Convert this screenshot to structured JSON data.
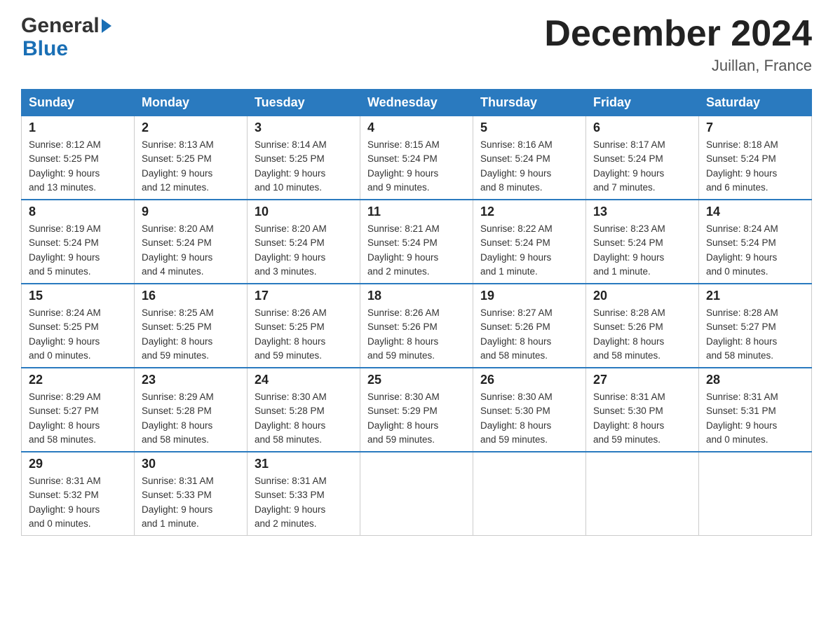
{
  "header": {
    "title": "December 2024",
    "location": "Juillan, France"
  },
  "logo": {
    "line1": "General",
    "line2": "Blue"
  },
  "weekdays": [
    "Sunday",
    "Monday",
    "Tuesday",
    "Wednesday",
    "Thursday",
    "Friday",
    "Saturday"
  ],
  "weeks": [
    [
      {
        "day": "1",
        "sunrise": "Sunrise: 8:12 AM",
        "sunset": "Sunset: 5:25 PM",
        "daylight": "Daylight: 9 hours",
        "minutes": "and 13 minutes."
      },
      {
        "day": "2",
        "sunrise": "Sunrise: 8:13 AM",
        "sunset": "Sunset: 5:25 PM",
        "daylight": "Daylight: 9 hours",
        "minutes": "and 12 minutes."
      },
      {
        "day": "3",
        "sunrise": "Sunrise: 8:14 AM",
        "sunset": "Sunset: 5:25 PM",
        "daylight": "Daylight: 9 hours",
        "minutes": "and 10 minutes."
      },
      {
        "day": "4",
        "sunrise": "Sunrise: 8:15 AM",
        "sunset": "Sunset: 5:24 PM",
        "daylight": "Daylight: 9 hours",
        "minutes": "and 9 minutes."
      },
      {
        "day": "5",
        "sunrise": "Sunrise: 8:16 AM",
        "sunset": "Sunset: 5:24 PM",
        "daylight": "Daylight: 9 hours",
        "minutes": "and 8 minutes."
      },
      {
        "day": "6",
        "sunrise": "Sunrise: 8:17 AM",
        "sunset": "Sunset: 5:24 PM",
        "daylight": "Daylight: 9 hours",
        "minutes": "and 7 minutes."
      },
      {
        "day": "7",
        "sunrise": "Sunrise: 8:18 AM",
        "sunset": "Sunset: 5:24 PM",
        "daylight": "Daylight: 9 hours",
        "minutes": "and 6 minutes."
      }
    ],
    [
      {
        "day": "8",
        "sunrise": "Sunrise: 8:19 AM",
        "sunset": "Sunset: 5:24 PM",
        "daylight": "Daylight: 9 hours",
        "minutes": "and 5 minutes."
      },
      {
        "day": "9",
        "sunrise": "Sunrise: 8:20 AM",
        "sunset": "Sunset: 5:24 PM",
        "daylight": "Daylight: 9 hours",
        "minutes": "and 4 minutes."
      },
      {
        "day": "10",
        "sunrise": "Sunrise: 8:20 AM",
        "sunset": "Sunset: 5:24 PM",
        "daylight": "Daylight: 9 hours",
        "minutes": "and 3 minutes."
      },
      {
        "day": "11",
        "sunrise": "Sunrise: 8:21 AM",
        "sunset": "Sunset: 5:24 PM",
        "daylight": "Daylight: 9 hours",
        "minutes": "and 2 minutes."
      },
      {
        "day": "12",
        "sunrise": "Sunrise: 8:22 AM",
        "sunset": "Sunset: 5:24 PM",
        "daylight": "Daylight: 9 hours",
        "minutes": "and 1 minute."
      },
      {
        "day": "13",
        "sunrise": "Sunrise: 8:23 AM",
        "sunset": "Sunset: 5:24 PM",
        "daylight": "Daylight: 9 hours",
        "minutes": "and 1 minute."
      },
      {
        "day": "14",
        "sunrise": "Sunrise: 8:24 AM",
        "sunset": "Sunset: 5:24 PM",
        "daylight": "Daylight: 9 hours",
        "minutes": "and 0 minutes."
      }
    ],
    [
      {
        "day": "15",
        "sunrise": "Sunrise: 8:24 AM",
        "sunset": "Sunset: 5:25 PM",
        "daylight": "Daylight: 9 hours",
        "minutes": "and 0 minutes."
      },
      {
        "day": "16",
        "sunrise": "Sunrise: 8:25 AM",
        "sunset": "Sunset: 5:25 PM",
        "daylight": "Daylight: 8 hours",
        "minutes": "and 59 minutes."
      },
      {
        "day": "17",
        "sunrise": "Sunrise: 8:26 AM",
        "sunset": "Sunset: 5:25 PM",
        "daylight": "Daylight: 8 hours",
        "minutes": "and 59 minutes."
      },
      {
        "day": "18",
        "sunrise": "Sunrise: 8:26 AM",
        "sunset": "Sunset: 5:26 PM",
        "daylight": "Daylight: 8 hours",
        "minutes": "and 59 minutes."
      },
      {
        "day": "19",
        "sunrise": "Sunrise: 8:27 AM",
        "sunset": "Sunset: 5:26 PM",
        "daylight": "Daylight: 8 hours",
        "minutes": "and 58 minutes."
      },
      {
        "day": "20",
        "sunrise": "Sunrise: 8:28 AM",
        "sunset": "Sunset: 5:26 PM",
        "daylight": "Daylight: 8 hours",
        "minutes": "and 58 minutes."
      },
      {
        "day": "21",
        "sunrise": "Sunrise: 8:28 AM",
        "sunset": "Sunset: 5:27 PM",
        "daylight": "Daylight: 8 hours",
        "minutes": "and 58 minutes."
      }
    ],
    [
      {
        "day": "22",
        "sunrise": "Sunrise: 8:29 AM",
        "sunset": "Sunset: 5:27 PM",
        "daylight": "Daylight: 8 hours",
        "minutes": "and 58 minutes."
      },
      {
        "day": "23",
        "sunrise": "Sunrise: 8:29 AM",
        "sunset": "Sunset: 5:28 PM",
        "daylight": "Daylight: 8 hours",
        "minutes": "and 58 minutes."
      },
      {
        "day": "24",
        "sunrise": "Sunrise: 8:30 AM",
        "sunset": "Sunset: 5:28 PM",
        "daylight": "Daylight: 8 hours",
        "minutes": "and 58 minutes."
      },
      {
        "day": "25",
        "sunrise": "Sunrise: 8:30 AM",
        "sunset": "Sunset: 5:29 PM",
        "daylight": "Daylight: 8 hours",
        "minutes": "and 59 minutes."
      },
      {
        "day": "26",
        "sunrise": "Sunrise: 8:30 AM",
        "sunset": "Sunset: 5:30 PM",
        "daylight": "Daylight: 8 hours",
        "minutes": "and 59 minutes."
      },
      {
        "day": "27",
        "sunrise": "Sunrise: 8:31 AM",
        "sunset": "Sunset: 5:30 PM",
        "daylight": "Daylight: 8 hours",
        "minutes": "and 59 minutes."
      },
      {
        "day": "28",
        "sunrise": "Sunrise: 8:31 AM",
        "sunset": "Sunset: 5:31 PM",
        "daylight": "Daylight: 9 hours",
        "minutes": "and 0 minutes."
      }
    ],
    [
      {
        "day": "29",
        "sunrise": "Sunrise: 8:31 AM",
        "sunset": "Sunset: 5:32 PM",
        "daylight": "Daylight: 9 hours",
        "minutes": "and 0 minutes."
      },
      {
        "day": "30",
        "sunrise": "Sunrise: 8:31 AM",
        "sunset": "Sunset: 5:33 PM",
        "daylight": "Daylight: 9 hours",
        "minutes": "and 1 minute."
      },
      {
        "day": "31",
        "sunrise": "Sunrise: 8:31 AM",
        "sunset": "Sunset: 5:33 PM",
        "daylight": "Daylight: 9 hours",
        "minutes": "and 2 minutes."
      },
      null,
      null,
      null,
      null
    ]
  ]
}
